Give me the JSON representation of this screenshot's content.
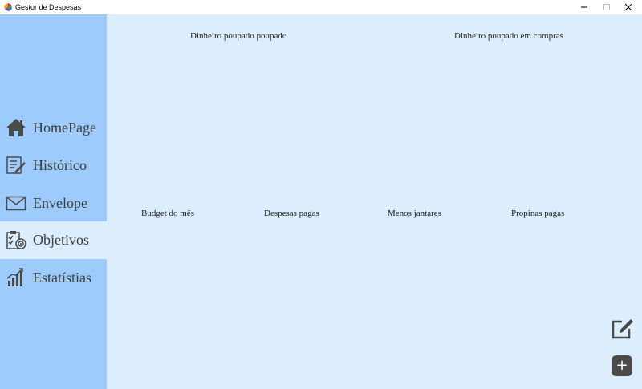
{
  "window": {
    "title": "Gestor de Despesas"
  },
  "sidebar": {
    "items": [
      {
        "label": "HomePage",
        "icon": "home-icon"
      },
      {
        "label": "Histórico",
        "icon": "history-icon"
      },
      {
        "label": "Envelope",
        "icon": "envelope-icon"
      },
      {
        "label": "Objetivos",
        "icon": "goals-icon",
        "active": true
      },
      {
        "label": "Estatístias",
        "icon": "bar-chart-icon"
      }
    ]
  },
  "main": {
    "top_labels": [
      "Dinheiro poupado poupado",
      "Dinheiro poupado em compras"
    ],
    "middle_labels": [
      "Budget do mês",
      "Despesas pagas",
      "Menos jantares",
      "Propinas pagas"
    ],
    "add_button_label": "+"
  },
  "colors": {
    "sidebar": "#9dcbfc",
    "main_background": "#dcedfd",
    "icon_dark": "#4a4a4a"
  }
}
